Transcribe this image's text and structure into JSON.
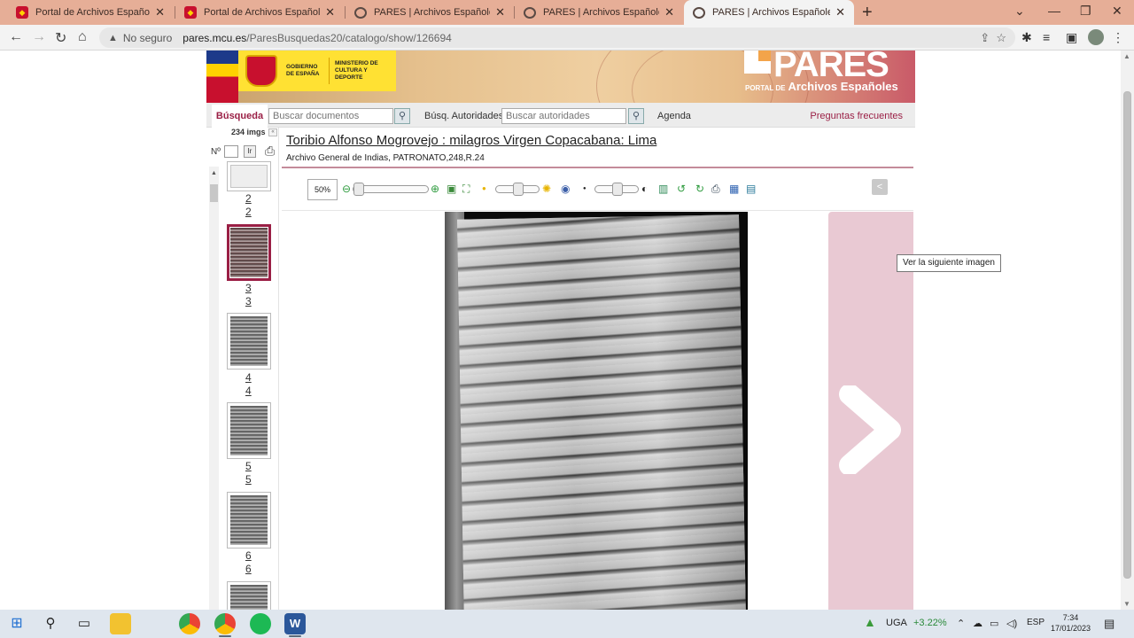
{
  "browser": {
    "tabs": [
      {
        "title": "Portal de Archivos Españoles (PA",
        "active": false,
        "favicon": "spain-flag-icon"
      },
      {
        "title": "Portal de Archivos Españoles (PA",
        "active": false,
        "favicon": "spain-flag-icon"
      },
      {
        "title": "PARES | Archivos Españoles",
        "active": false,
        "favicon": "globe-icon"
      },
      {
        "title": "PARES | Archivos Españoles",
        "active": false,
        "favicon": "globe-icon"
      },
      {
        "title": "PARES | Archivos Españoles",
        "active": true,
        "favicon": "globe-icon"
      }
    ],
    "security_label": "No seguro",
    "url_host": "pares.mcu.es",
    "url_path": "/ParesBusquedas20/catalogo/show/126694"
  },
  "banner": {
    "gov_text": "GOBIERNO DE ESPAÑA",
    "ministry_text": "MINISTERIO DE CULTURA Y DEPORTE",
    "logo": "PARES",
    "portal_prefix": "PORTAL DE",
    "portal_name": "Archivos Españoles"
  },
  "searchbar": {
    "busqueda_tab": "Búsqueda",
    "doc_placeholder": "Buscar documentos",
    "autoridades_label": "Búsq. Autoridades",
    "autoridades_placeholder": "Buscar autoridades",
    "agenda": "Agenda",
    "faq": "Preguntas frecuentes"
  },
  "sidebar": {
    "img_count": "234 imgs",
    "n_label": "Nº",
    "go_label": "Ir",
    "thumbnails": [
      {
        "label": "2",
        "sub": "2",
        "selected": false
      },
      {
        "label": "3",
        "sub": "3",
        "selected": true
      },
      {
        "label": "4",
        "sub": "4",
        "selected": false
      },
      {
        "label": "5",
        "sub": "5",
        "selected": false
      },
      {
        "label": "6",
        "sub": "6",
        "selected": false
      }
    ]
  },
  "document": {
    "title": "Toribio Alfonso Mogrovejo : milagros Virgen Copacabana: Lima",
    "reference": "Archivo General de Indias, PATRONATO,248,R.24"
  },
  "viewer": {
    "zoom": "50%",
    "next_tooltip": "Ver la siguiente imagen",
    "accent": "#9a1f45",
    "next_panel_color": "#e9c9d3"
  },
  "taskbar": {
    "stock_symbol": "UGA",
    "stock_change": "+3.22%",
    "language": "ESP",
    "time": "7:34",
    "date": "17/01/2023"
  }
}
